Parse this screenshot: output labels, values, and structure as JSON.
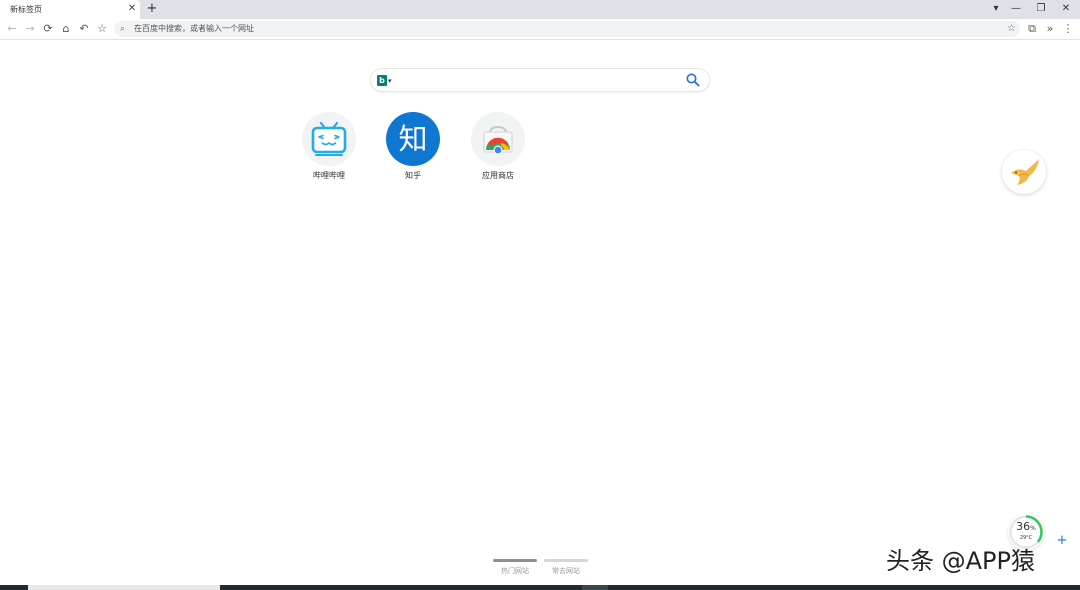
{
  "tab": {
    "title": "新标签页",
    "close": "✕"
  },
  "new_tab": "+",
  "window": {
    "dropdown": "▾",
    "minimize": "—",
    "restore": "❐",
    "close": "✕"
  },
  "toolbar": {
    "back": "←",
    "forward": "→",
    "reload": "⟳",
    "home": "⌂",
    "undo": "↶",
    "bookmark": "☆"
  },
  "omnibox": {
    "search_icon": "⌕",
    "placeholder": "在百度中搜索，或者输入一个网址",
    "star": "☆"
  },
  "toolbar_right": {
    "screenshot": "⧉",
    "more": "»",
    "menu": "⋮"
  },
  "search": {
    "engine_letter": "b",
    "caret": "▾"
  },
  "shortcuts": [
    {
      "label": "哔哩哔哩"
    },
    {
      "label": "知乎",
      "char": "知"
    },
    {
      "label": "应用商店"
    }
  ],
  "perf": {
    "value": "36",
    "unit": "%",
    "temp": "29°C",
    "level": 0.36
  },
  "plus": "+",
  "pager": [
    "热门网站",
    "常去网站"
  ],
  "watermark": "头条 @APP猿",
  "colors": {
    "accent": "#1a73e8",
    "zhihu": "#0f76d2",
    "bilibili": "#23ade5",
    "perf_ring": "#3cc45a"
  }
}
